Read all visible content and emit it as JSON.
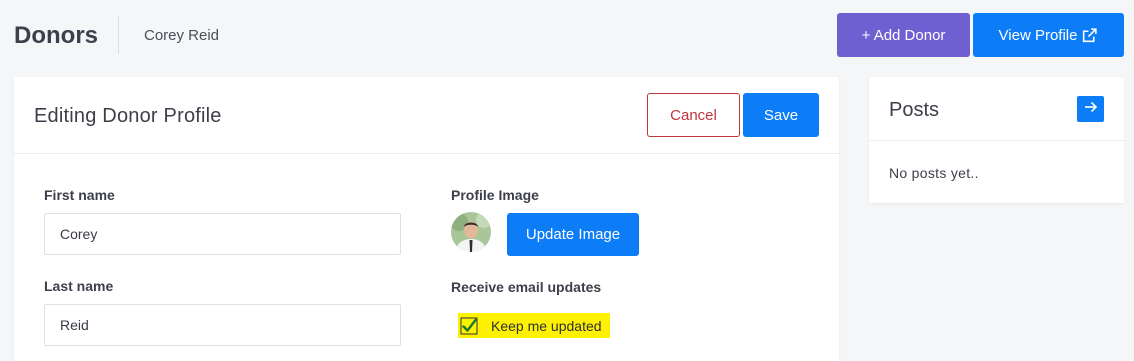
{
  "header": {
    "title": "Donors",
    "subtitle": "Corey Reid",
    "add_donor_label": "+ Add Donor",
    "view_profile_label": "View Profile"
  },
  "editor": {
    "title": "Editing Donor Profile",
    "cancel_label": "Cancel",
    "save_label": "Save",
    "first_name_label": "First name",
    "first_name_value": "Corey",
    "last_name_label": "Last name",
    "last_name_value": "Reid",
    "profile_image_label": "Profile Image",
    "update_image_label": "Update Image",
    "email_updates_label": "Receive email updates",
    "keep_updated_label": "Keep me updated",
    "keep_updated_checked": true
  },
  "posts": {
    "title": "Posts",
    "empty_text": "No posts yet.."
  },
  "colors": {
    "primary": "#0d7df7",
    "add_donor": "#6f5fd1",
    "cancel": "#c0353f",
    "highlight": "#fff200"
  },
  "icons": {
    "view_profile": "external-link-icon",
    "posts_go": "arrow-right-icon",
    "checkbox": "checkmark-icon"
  }
}
